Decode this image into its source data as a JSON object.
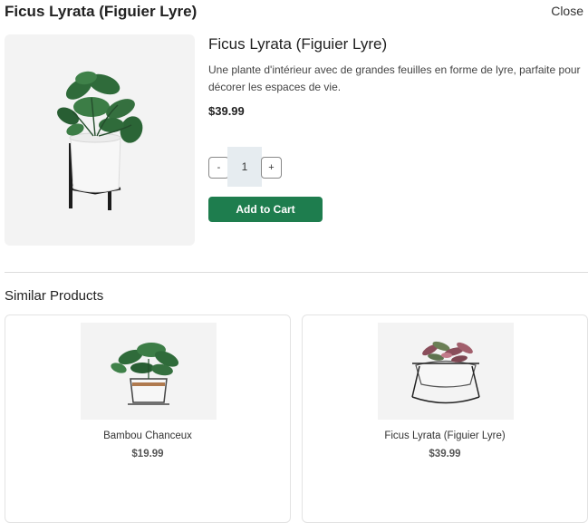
{
  "header": {
    "title": "Ficus Lyrata (Figuier Lyre)",
    "close_label": "Close"
  },
  "product": {
    "name": "Ficus Lyrata (Figuier Lyre)",
    "description": "Une plante d'intérieur avec de grandes feuilles en forme de lyre, parfaite pour décorer les espaces de vie.",
    "price": "$39.99",
    "quantity": "1",
    "decrement_label": "-",
    "increment_label": "+",
    "add_to_cart_label": "Add to Cart"
  },
  "similar": {
    "heading": "Similar Products",
    "items": [
      {
        "name": "Bambou Chanceux",
        "price": "$19.99"
      },
      {
        "name": "Ficus Lyrata (Figuier Lyre)",
        "price": "$39.99"
      }
    ]
  },
  "colors": {
    "accent": "#1e7d4e",
    "image_bg": "#f3f3f3",
    "qty_bg": "#e6ecf0"
  }
}
